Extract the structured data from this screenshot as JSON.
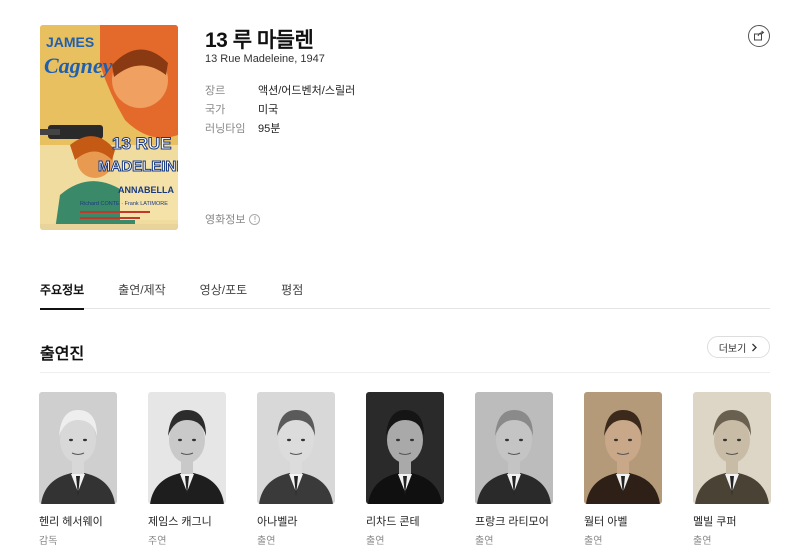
{
  "movie": {
    "title": "13 루 마들렌",
    "original": "13 Rue Madeleine, 1947",
    "info": [
      {
        "label": "장르",
        "value": "액션/어드벤처/스릴러"
      },
      {
        "label": "국가",
        "value": "미국"
      },
      {
        "label": "러닝타임",
        "value": "95분"
      }
    ],
    "info_link": "영화정보",
    "info_link_icon": "!"
  },
  "poster": {
    "top_name_1": "JAMES",
    "top_name_2": "Cagney",
    "title_1": "13 RUE",
    "title_2": "MADELEINE",
    "co_star": "ANNABELLA",
    "co_stars": "Richard CONTE · Frank LATIMORE"
  },
  "tabs": [
    "주요정보",
    "출연/제작",
    "영상/포토",
    "평점"
  ],
  "cast_section": {
    "title": "출연진",
    "more": "더보기",
    "people": [
      {
        "name": "헨리 헤서웨이",
        "role": "감독",
        "bg": "#cfcfcf",
        "skin": "#d8d8d8",
        "hair": "#eeeeee",
        "suit": "#333333"
      },
      {
        "name": "제임스 캐그니",
        "role": "주연",
        "bg": "#e6e6e6",
        "skin": "#c9c9c9",
        "hair": "#2c2c2c",
        "suit": "#1e1e1e"
      },
      {
        "name": "아나벨라",
        "role": "출연",
        "bg": "#d8d8d8",
        "skin": "#dcdcdc",
        "hair": "#5a5a5a",
        "suit": "#3a3a3a"
      },
      {
        "name": "리차드 콘테",
        "role": "출연",
        "bg": "#2a2a2a",
        "skin": "#a9a9a9",
        "hair": "#151515",
        "suit": "#101010"
      },
      {
        "name": "프랑크 라티모어",
        "role": "출연",
        "bg": "#bcbcbc",
        "skin": "#c4c4c4",
        "hair": "#8a8a8a",
        "suit": "#2a2a2a"
      },
      {
        "name": "월터 아벨",
        "role": "출연",
        "bg": "#b59a7a",
        "skin": "#c8a888",
        "hair": "#3b2a1c",
        "suit": "#2e2016"
      },
      {
        "name": "멜빌 쿠퍼",
        "role": "출연",
        "bg": "#ddd6c6",
        "skin": "#c8bca6",
        "hair": "#6a6050",
        "suit": "#4a4234"
      }
    ]
  }
}
